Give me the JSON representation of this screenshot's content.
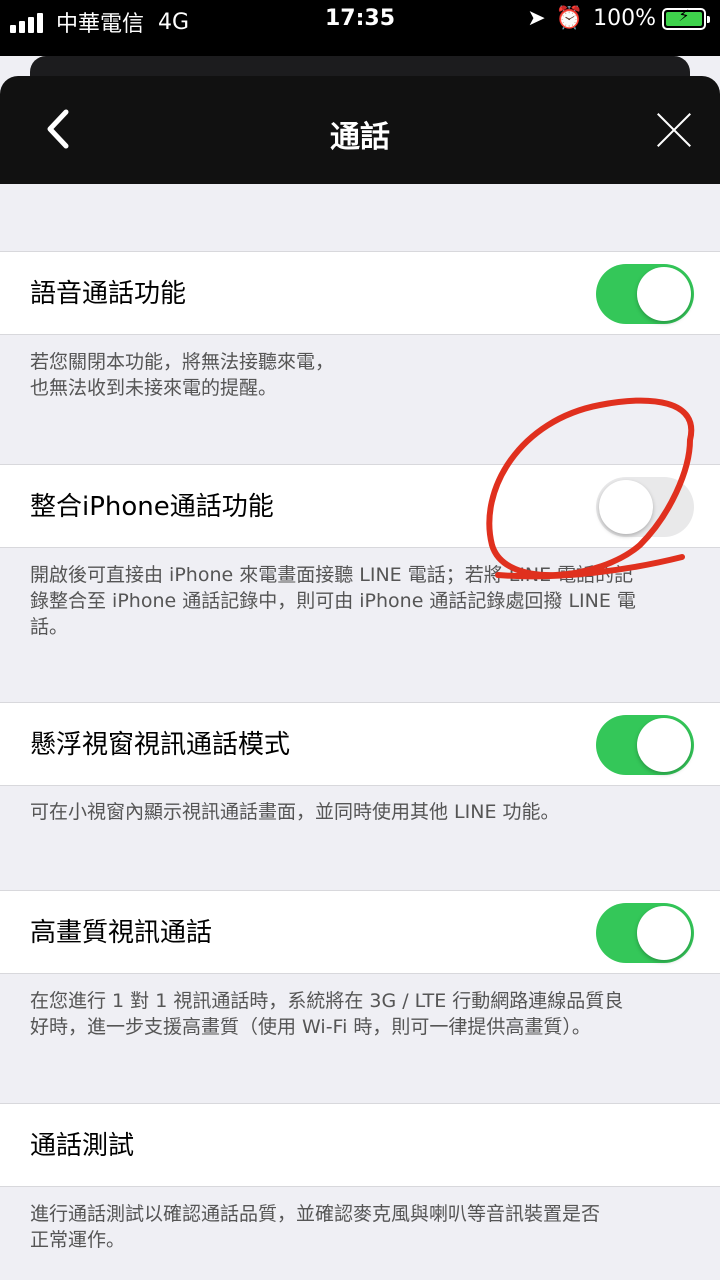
{
  "status_bar": {
    "carrier": "中華電信",
    "network": "4G",
    "time": "17:35",
    "battery": "100%"
  },
  "nav": {
    "title": "通話",
    "back_glyph": "〈",
    "close_label": ""
  },
  "settings": [
    {
      "label": "語音通話功能",
      "on": true,
      "desc": [
        "若您關閉本功能，將無法接聽來電，",
        "也無法收到未接來電的提醒。"
      ]
    },
    {
      "label": "整合iPhone通話功能",
      "on": false,
      "desc": [
        "開啟後可直接由 iPhone 來電畫面接聽 LINE 電話；若將 LINE 電話的記",
        "錄整合至 iPhone 通話記錄中，則可由 iPhone 通話記錄處回撥 LINE 電",
        "話。"
      ]
    },
    {
      "label": "懸浮視窗視訊通話模式",
      "on": true,
      "desc": [
        "可在小視窗內顯示視訊通話畫面，並同時使用其他 LINE 功能。"
      ]
    },
    {
      "label": "高畫質視訊通話",
      "on": true,
      "desc": [
        "在您進行 1 對 1 視訊通話時，系統將在 3G / LTE 行動網路連線品質良",
        "好時，進一步支援高畫質（使用 Wi-Fi 時，則可一律提供高畫質）。"
      ]
    },
    {
      "label": "通話測試",
      "desc": [
        "進行通話測試以確認通話品質，並確認麥克風與喇叭等音訊裝置是否",
        "正常運作。"
      ]
    }
  ],
  "colors": {
    "toggle_on": "#34c759",
    "annotation": "#e0301e"
  }
}
